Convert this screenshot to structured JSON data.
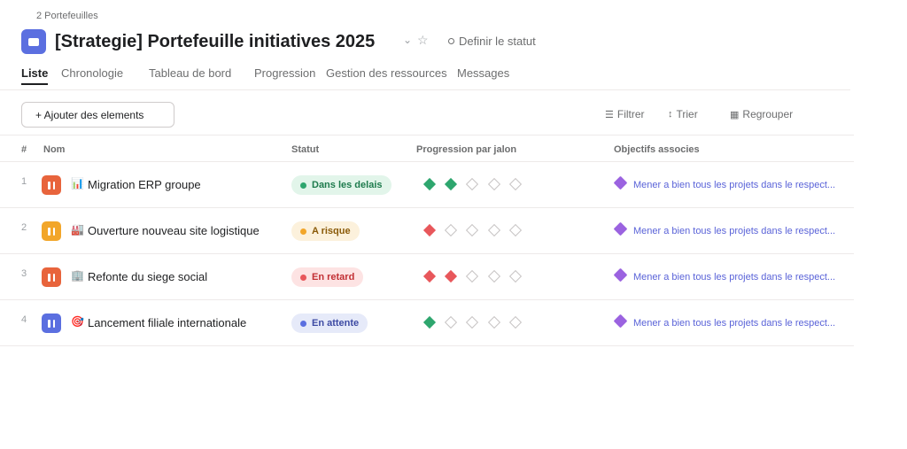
{
  "breadcrumb": "2 Portefeuilles",
  "title": "[Strategie] Portefeuille initiatives 2025",
  "status_action": "Definir le statut",
  "tabs": [
    {
      "label": "Liste",
      "active": true
    },
    {
      "label": "Chronologie",
      "active": false
    },
    {
      "label": "Tableau de bord",
      "active": false
    },
    {
      "label": "Progression",
      "active": false
    },
    {
      "label": "Gestion des ressources",
      "active": false
    },
    {
      "label": "Messages",
      "active": false
    }
  ],
  "toolbar": {
    "add_label": "+ Ajouter des elements",
    "filter_label": "Filtrer",
    "sort_label": "Trier",
    "group_label": "Regrouper"
  },
  "columns": {
    "num": "#",
    "name": "Nom",
    "status": "Statut",
    "milestones": "Progression par jalon",
    "objectives": "Objectifs associes"
  },
  "colors": {
    "accent": "#5b6fe0",
    "milestone_green": "#2ea66e",
    "milestone_red": "#e8575b",
    "objective_purple": "#9b63e0"
  },
  "rows": [
    {
      "num": "1",
      "icon_color": "#e8643c",
      "emoji": "📊",
      "name": "Migration ERP groupe",
      "status": {
        "label": "Dans les delais",
        "bg": "#e2f5ea",
        "fg": "#1e7b4d",
        "dot": "#2ea66e"
      },
      "milestones": [
        "#2ea66e",
        "#2ea66e",
        null,
        null,
        null
      ],
      "objective": "Mener a bien tous les projets dans le respect..."
    },
    {
      "num": "2",
      "icon_color": "#f2a62a",
      "emoji": "🏭",
      "name": "Ouverture nouveau site logistique",
      "status": {
        "label": "A risque",
        "bg": "#fcf1dc",
        "fg": "#8a5a08",
        "dot": "#f2a62a"
      },
      "milestones": [
        "#e8575b",
        null,
        null,
        null,
        null
      ],
      "objective": "Mener a bien tous les projets dans le respect..."
    },
    {
      "num": "3",
      "icon_color": "#e8643c",
      "emoji": "🏢",
      "name": "Refonte du siege social",
      "status": {
        "label": "En retard",
        "bg": "#fde3e3",
        "fg": "#c22f34",
        "dot": "#e8575b"
      },
      "milestones": [
        "#e8575b",
        "#e8575b",
        null,
        null,
        null
      ],
      "objective": "Mener a bien tous les projets dans le respect..."
    },
    {
      "num": "4",
      "icon_color": "#5b6fe0",
      "emoji": "🎯",
      "name": "Lancement filiale internationale",
      "status": {
        "label": "En attente",
        "bg": "#e6eaf9",
        "fg": "#3d4aa3",
        "dot": "#5b6fe0"
      },
      "milestones": [
        "#2ea66e",
        null,
        null,
        null,
        null
      ],
      "objective": "Mener a bien tous les projets dans le respect..."
    }
  ]
}
